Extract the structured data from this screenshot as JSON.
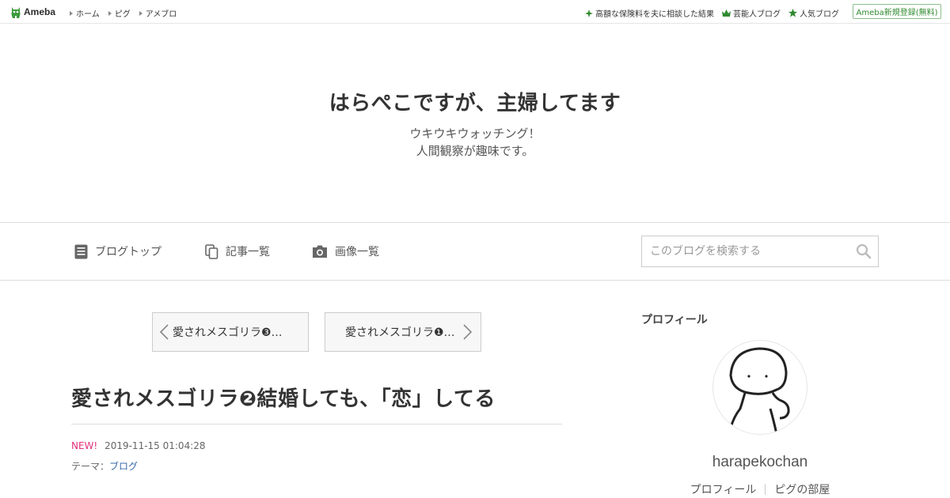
{
  "topbar": {
    "logo_text": "Ameba",
    "nav": [
      "ホーム",
      "ピグ",
      "アメブロ"
    ],
    "right_links": [
      {
        "label": "高額な保険料を夫に相談した結果",
        "icon": "sparkle-icon"
      },
      {
        "label": "芸能人ブログ",
        "icon": "crown-icon"
      },
      {
        "label": "人気ブログ",
        "icon": "star-icon"
      }
    ],
    "register_label": "Ameba新規登録(無料)",
    "accent_color": "#2f8a2f"
  },
  "header": {
    "title": "はらぺこですが、主婦してます",
    "description_lines": [
      "ウキウキウォッチング！",
      "人間観察が趣味です。"
    ]
  },
  "navbar": {
    "items": [
      {
        "label": "ブログトップ",
        "icon": "document-icon"
      },
      {
        "label": "記事一覧",
        "icon": "copy-icon"
      },
      {
        "label": "画像一覧",
        "icon": "camera-icon"
      }
    ],
    "search_placeholder": "このブログを検索する"
  },
  "article": {
    "prev_label": "愛されメスゴリラ❸…",
    "next_label": "愛されメスゴリラ❶…",
    "title": "愛されメスゴリラ❷結婚しても、「恋」してる",
    "new_badge": "NEW!",
    "datetime": "2019-11-15 01:04:28",
    "theme_prefix": "テーマ：",
    "theme_link": "ブログ"
  },
  "sidebar": {
    "heading": "プロフィール",
    "username": "harapekochan",
    "links": [
      "プロフィール",
      "ピグの部屋"
    ]
  }
}
